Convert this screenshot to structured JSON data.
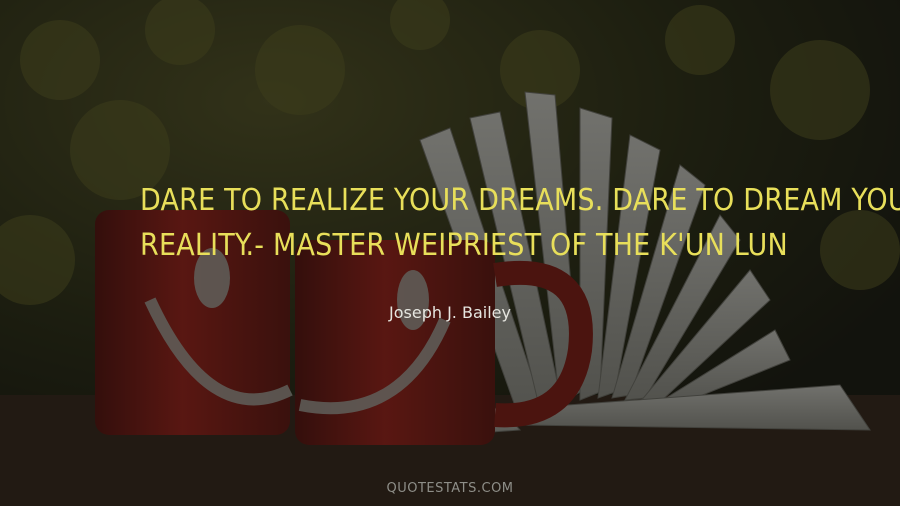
{
  "quote": {
    "line1": "DARE TO REALIZE YOUR DREAMS. DARE TO DREAM YOUR",
    "line2": "REALITY.- MASTER WEIPRIEST OF THE K'UN LUN"
  },
  "author": "Joseph J. Bailey",
  "site": "QUOTESTATS.COM",
  "colors": {
    "quote_text": "#e8df5a",
    "author_text": "#e6e6e0",
    "site_text": "#8e8e88",
    "mug": "#a8241c"
  }
}
